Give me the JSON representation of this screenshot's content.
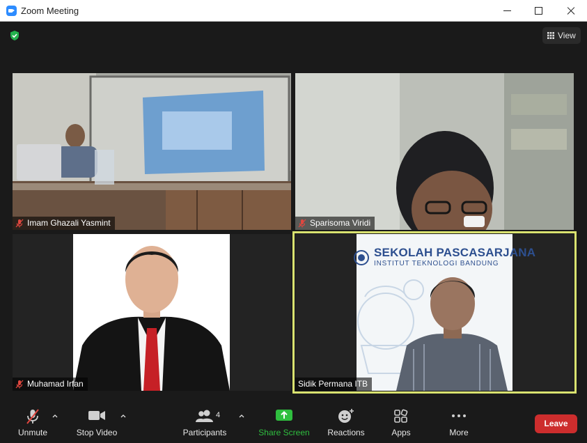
{
  "window": {
    "title": "Zoom Meeting"
  },
  "top_bar": {
    "view_label": "View"
  },
  "participants": [
    {
      "name": "Imam Ghazali Yasmint",
      "muted": true
    },
    {
      "name": "Sparisoma Viridi",
      "muted": true
    },
    {
      "name": "Muhamad Irfan",
      "muted": true
    },
    {
      "name": "Sidik Permana ITB",
      "muted": false,
      "active_speaker": true
    }
  ],
  "slide": {
    "line1": "SEKOLAH PASCASARJANA",
    "line2": "INSTITUT TEKNOLOGI BANDUNG"
  },
  "toolbar": {
    "unmute": "Unmute",
    "stop_video": "Stop Video",
    "participants": "Participants",
    "participants_count": "4",
    "share_screen": "Share Screen",
    "reactions": "Reactions",
    "apps": "Apps",
    "more": "More",
    "leave": "Leave"
  },
  "colors": {
    "share_green": "#2fbf3f",
    "leave_red": "#cd2d2d",
    "active_border": "#d9e26f",
    "muted_red": "#e0473f"
  }
}
